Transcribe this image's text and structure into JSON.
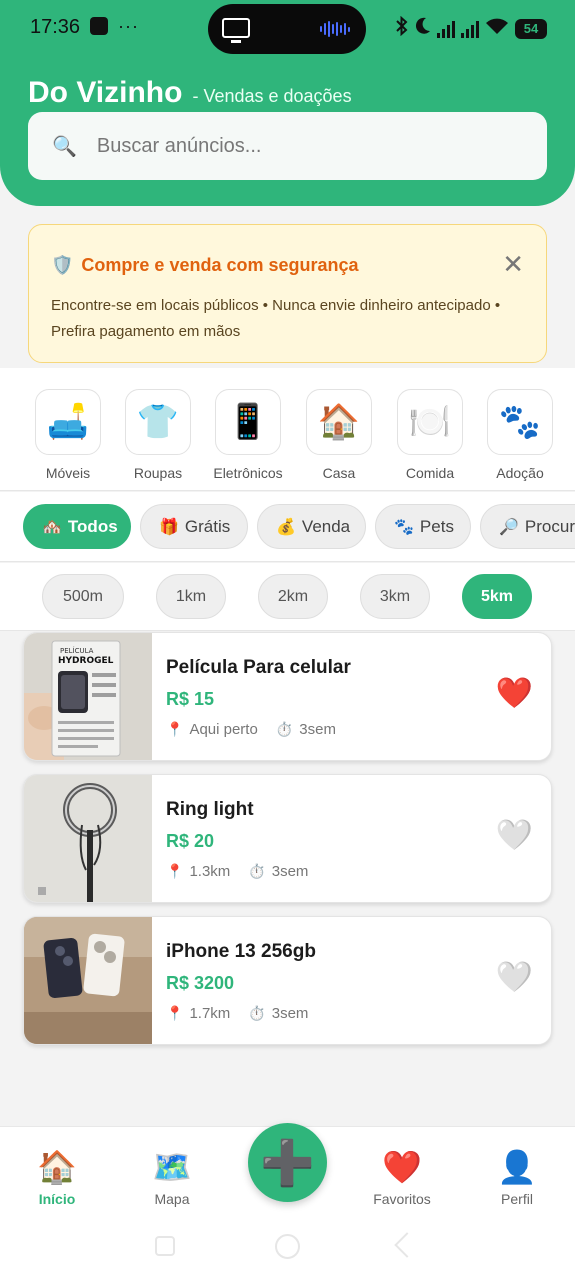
{
  "status_bar": {
    "time": "17:36",
    "dots": "···",
    "battery": "54"
  },
  "header": {
    "title": "Do Vizinho",
    "subtitle": "- Vendas e doações",
    "search_placeholder": "Buscar anúncios..."
  },
  "safety_banner": {
    "title": "Compre e venda com segurança",
    "text": "Encontre-se em locais públicos • Nunca envie dinheiro antecipado • Prefira pagamento em mãos",
    "close": "✕"
  },
  "categories": [
    {
      "label": "Móveis",
      "icon": "🛋️"
    },
    {
      "label": "Roupas",
      "icon": "👕"
    },
    {
      "label": "Eletrônicos",
      "icon": "📱"
    },
    {
      "label": "Casa",
      "icon": "🏠"
    },
    {
      "label": "Comida",
      "icon": "🍽️"
    },
    {
      "label": "Adoção",
      "icon": "🐾"
    }
  ],
  "filters": [
    {
      "label": "Todos",
      "icon": "🏘️",
      "active": true
    },
    {
      "label": "Grátis",
      "icon": "🎁"
    },
    {
      "label": "Venda",
      "icon": "💰"
    },
    {
      "label": "Pets",
      "icon": "🐾"
    },
    {
      "label": "Procur",
      "icon": "🔎"
    }
  ],
  "distances": [
    {
      "label": "500m"
    },
    {
      "label": "1km"
    },
    {
      "label": "2km"
    },
    {
      "label": "3km"
    },
    {
      "label": "5km",
      "active": true
    }
  ],
  "listings": [
    {
      "title": "Película Para celular",
      "price": "R$ 15",
      "distance": "Aqui perto",
      "time": "3sem",
      "favorite": true,
      "thumb_text_1": "PELÍCULA",
      "thumb_text_2": "HYDROGEL"
    },
    {
      "title": "Ring light",
      "price": "R$ 20",
      "distance": "1.3km",
      "time": "3sem",
      "favorite": false
    },
    {
      "title": "iPhone 13 256gb",
      "price": "R$ 3200",
      "distance": "1.7km",
      "time": "3sem",
      "favorite": false
    }
  ],
  "bottom_nav": [
    {
      "label": "Início",
      "icon": "🏠",
      "active": true
    },
    {
      "label": "Mapa",
      "icon": "🗺️"
    },
    {
      "label": "Favoritos",
      "icon": "❤️"
    },
    {
      "label": "Perfil",
      "icon": "👤"
    }
  ],
  "fab_icon": "➕",
  "colors": {
    "primary": "#2fb57b",
    "banner_bg": "#fff8dc",
    "banner_title": "#e0620f",
    "heart_active": "#e53935"
  }
}
